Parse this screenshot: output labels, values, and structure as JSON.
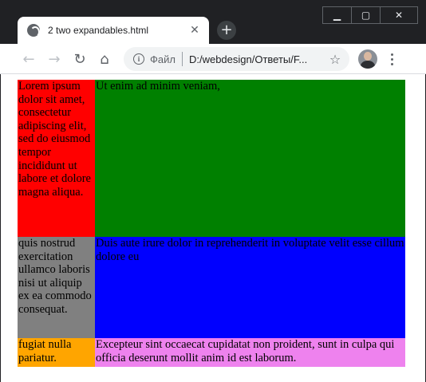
{
  "tab": {
    "title": "2 two expandables.html",
    "close_glyph": "✕"
  },
  "new_tab_glyph": "+",
  "window_controls": {
    "minimize": "▁",
    "maximize": "▢",
    "close": "✕"
  },
  "toolbar": {
    "back_glyph": "←",
    "forward_glyph": "→",
    "reload_glyph": "↻",
    "home_glyph": "⌂",
    "info_glyph": "i",
    "scheme_label": "Файл",
    "url": "D:/webdesign/Ответы/F...",
    "star_glyph": "☆"
  },
  "content": {
    "cells": [
      {
        "text": "Lorem ipsum dolor sit amet, consectetur adipiscing elit, sed do eiusmod tempor incididunt ut labore et dolore magna aliqua.",
        "color": "#ff0000"
      },
      {
        "text": "Ut enim ad minim veniam,",
        "color": "#008000"
      },
      {
        "text": "quis nostrud exercitation ullamco laboris nisi ut aliquip ex ea commodo consequat.",
        "color": "#808080"
      },
      {
        "text": "Duis aute irure dolor in reprehenderit in voluptate velit esse cillum dolore eu",
        "color": "#0000ff"
      },
      {
        "text": "fugiat nulla pariatur.",
        "color": "#ffa500"
      },
      {
        "text": "Excepteur sint occaecat cupidatat non proident, sunt in culpa qui officia deserunt mollit anim id est laborum.",
        "color": "#ee82ee"
      }
    ]
  },
  "colors": {
    "titlebar": "#202124",
    "toolbar": "#ffffff",
    "omnibox": "#f1f3f4"
  }
}
